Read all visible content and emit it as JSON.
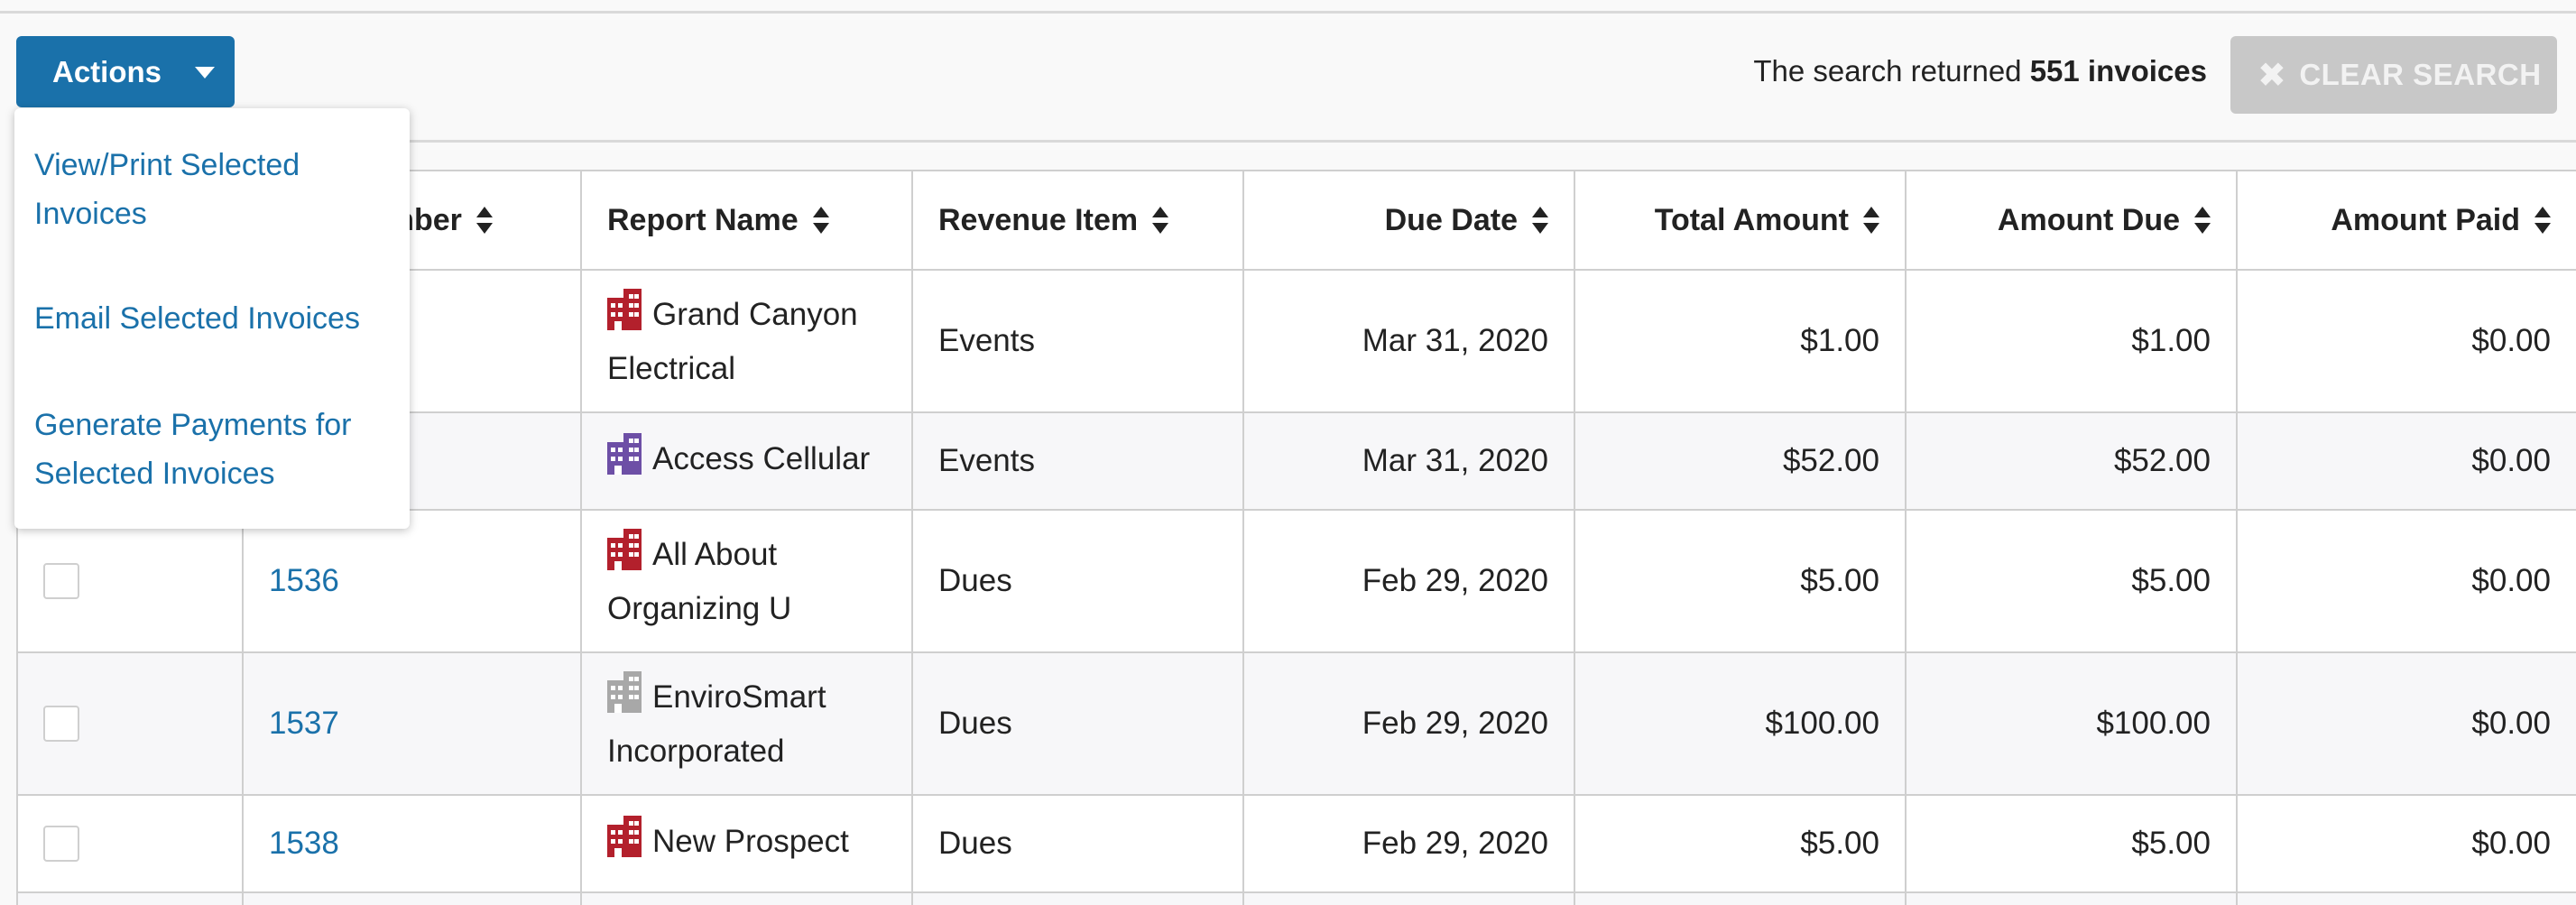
{
  "toolbar": {
    "actions_label": "Actions",
    "result_prefix": "The search returned",
    "result_count": "551 invoices",
    "clear_label": "CLEAR SEARCH"
  },
  "menu": {
    "items": [
      "View/Print Selected Invoices",
      "Email Selected Invoices",
      "Generate Payments for Selected Invoices"
    ]
  },
  "table": {
    "columns": [
      "umber",
      "Report Name",
      "Revenue Item",
      "Due Date",
      "Total Amount",
      "Amount Due",
      "Amount Paid"
    ],
    "rows": [
      {
        "number": "",
        "name": "Grand Canyon Electrical",
        "revenue": "Events",
        "due_date": "Mar 31, 2020",
        "total": "$1.00",
        "due": "$1.00",
        "paid": "$0.00",
        "icon_color": "#b3202c"
      },
      {
        "number": "",
        "name": "Access Cellular",
        "revenue": "Events",
        "due_date": "Mar 31, 2020",
        "total": "$52.00",
        "due": "$52.00",
        "paid": "$0.00",
        "icon_color": "#6d4fa6"
      },
      {
        "number": "1536",
        "name": "All About Organizing U",
        "revenue": "Dues",
        "due_date": "Feb 29, 2020",
        "total": "$5.00",
        "due": "$5.00",
        "paid": "$0.00",
        "icon_color": "#b3202c"
      },
      {
        "number": "1537",
        "name": "EnviroSmart Incorporated",
        "revenue": "Dues",
        "due_date": "Feb 29, 2020",
        "total": "$100.00",
        "due": "$100.00",
        "paid": "$0.00",
        "icon_color": "#a8a8a8"
      },
      {
        "number": "1538",
        "name": "New Prospect",
        "revenue": "Dues",
        "due_date": "Feb 29, 2020",
        "total": "$5.00",
        "due": "$5.00",
        "paid": "$0.00",
        "icon_color": "#b3202c"
      }
    ]
  },
  "colors": {
    "primary": "#1a71aa",
    "clear_button_bg": "#c8c8c8",
    "org_red": "#b3202c",
    "org_purple": "#6d4fa6",
    "org_gray": "#a8a8a8"
  },
  "icons": {
    "caret": "caret-down-icon",
    "clear": "close-icon",
    "sort": "sort-icon",
    "organization": "building-icon"
  }
}
